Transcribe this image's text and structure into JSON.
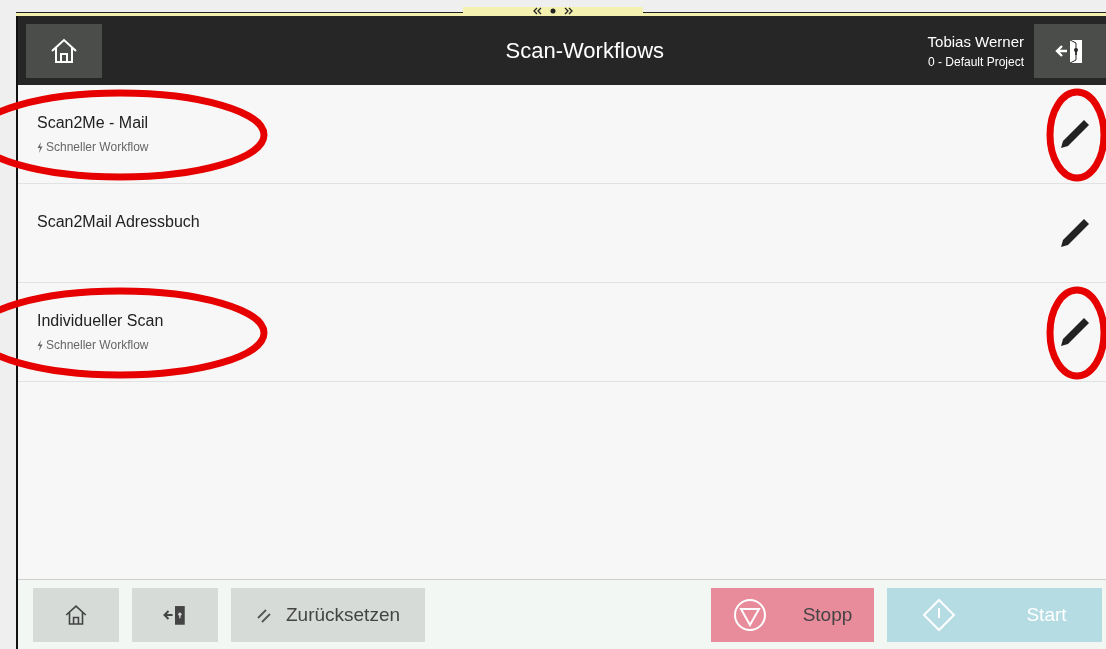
{
  "header": {
    "title": "Scan-Workflows",
    "user": "Tobias Werner",
    "project": "0 - Default Project"
  },
  "workflows": [
    {
      "name": "Scan2Me - Mail",
      "subtitle": "Schneller Workflow",
      "highlighted": true
    },
    {
      "name": "Scan2Mail Adressbuch",
      "highlighted": false
    },
    {
      "name": "Individueller Scan",
      "subtitle": "Schneller Workflow",
      "highlighted": true
    }
  ],
  "footer": {
    "reset": "Zurücksetzen",
    "stop": "Stopp",
    "start": "Start",
    "start_disabled": true
  }
}
